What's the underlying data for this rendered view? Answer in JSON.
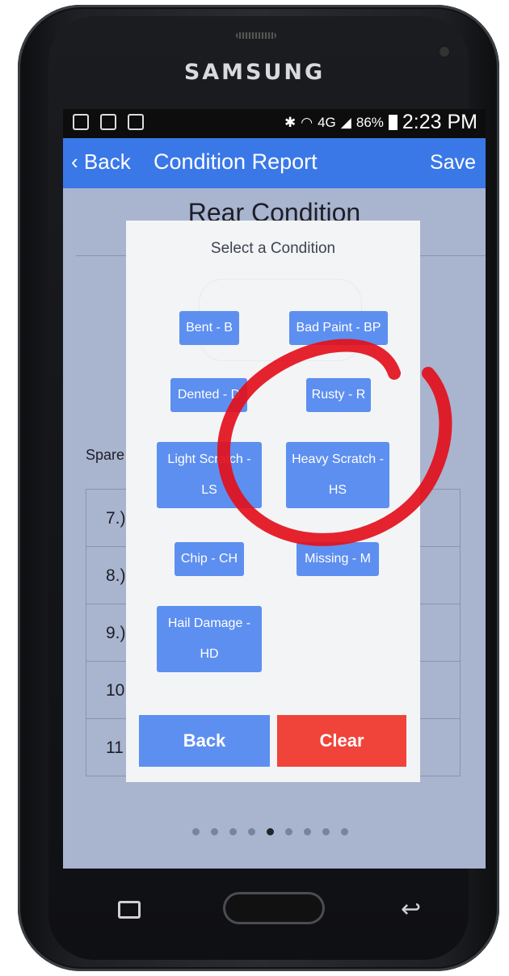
{
  "device": {
    "brand": "SAMSUNG"
  },
  "status_bar": {
    "battery": "86%",
    "time": "2:23 PM",
    "network": "4G"
  },
  "header": {
    "back_label": "Back",
    "title": "Condition Report",
    "save_label": "Save"
  },
  "page": {
    "heading": "Rear Condition",
    "spare_label": "Spare",
    "rows": [
      "7.)",
      "8.)",
      "9.)",
      "10",
      "11"
    ],
    "pager": {
      "count": 9,
      "active_index": 4
    }
  },
  "modal": {
    "title": "Select a Condition",
    "conditions": [
      "Bent - B",
      "Bad Paint - BP",
      "Dented - D",
      "Rusty - R",
      "Light Scratch - LS",
      "Heavy Scratch - HS",
      "Chip - CH",
      "Missing - M",
      "Hail Damage - HD"
    ],
    "back_label": "Back",
    "clear_label": "Clear"
  },
  "colors": {
    "accent": "#3a78e8",
    "button": "#5d8ff0",
    "danger": "#f0433a",
    "annotation": "#e3101c"
  }
}
